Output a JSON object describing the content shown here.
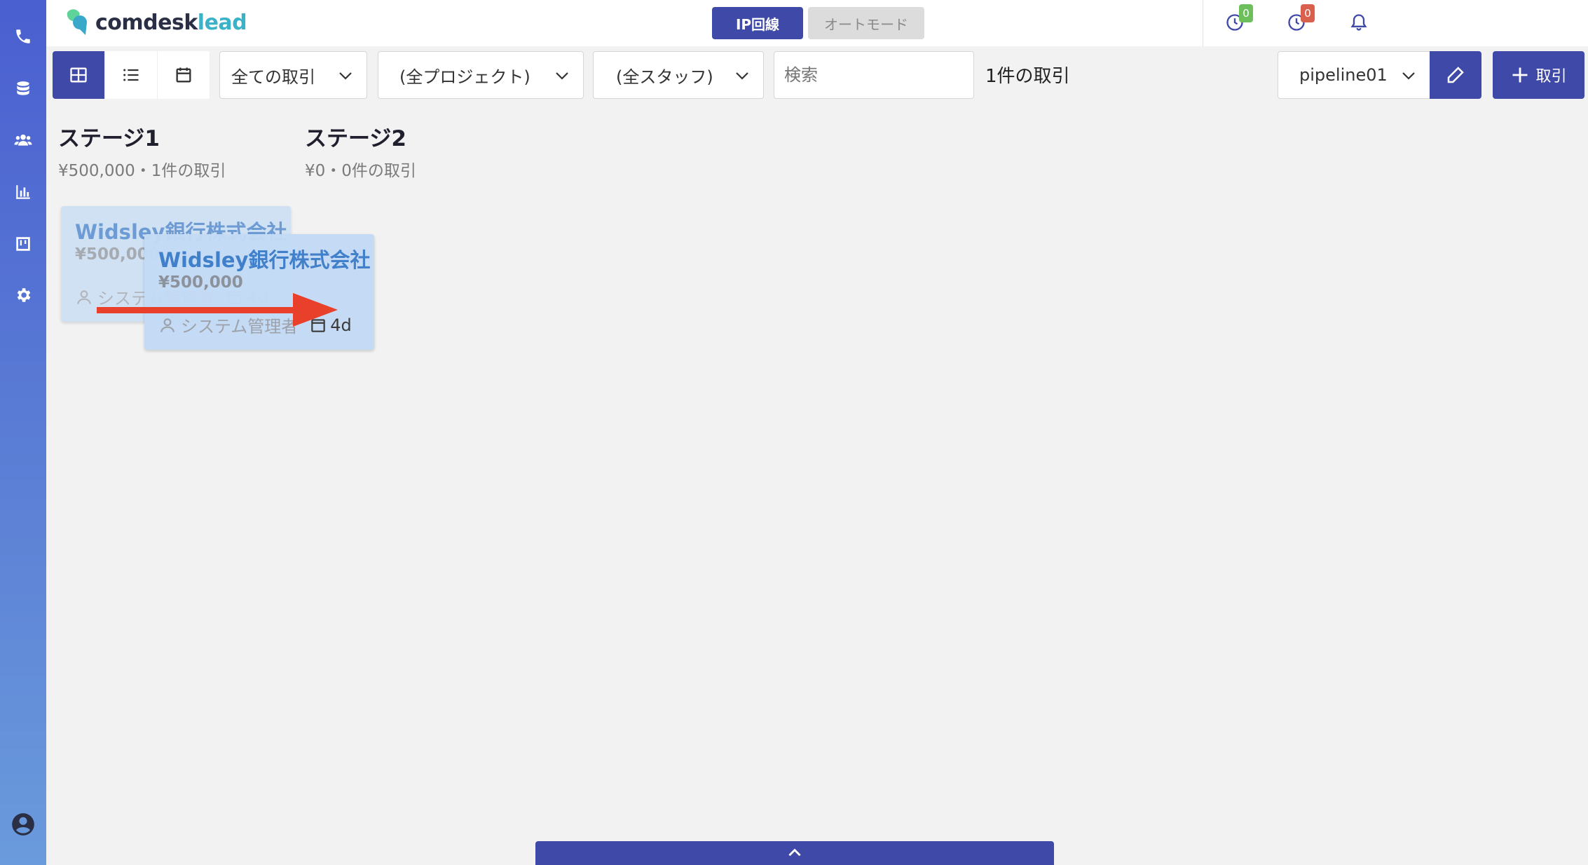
{
  "app": {
    "logo_text": "comdesk",
    "logo_text_accent": "lead"
  },
  "modes": {
    "ip_label": "IP回線",
    "auto_label": "オートモード"
  },
  "header_icons": {
    "timer_green_count": "0",
    "timer_red_count": "0",
    "green_color": "#6cbf5b",
    "red_color": "#d9604c"
  },
  "sidebar": {
    "items": [
      "phone-icon",
      "database-icon",
      "users-icon",
      "chart-icon",
      "board-icon",
      "settings-icon"
    ],
    "bottom": "account-icon"
  },
  "toolbar": {
    "views": [
      "board-view-icon",
      "list-view-icon",
      "calendar-view-icon"
    ],
    "deal_filter": "全ての取引",
    "project_filter": "(全プロジェクト)",
    "staff_filter": "(全スタッフ)",
    "search_placeholder": "検索",
    "deal_count": "1件の取引",
    "pipeline": "pipeline01",
    "add_label": "取引"
  },
  "stages": [
    {
      "title": "ステージ1",
      "summary": "¥500,000・1件の取引"
    },
    {
      "title": "ステージ2",
      "summary": "¥0・0件の取引"
    }
  ],
  "card": {
    "company": "Widsley銀行株式会社",
    "amount": "¥500,000",
    "owner": "システム管理者",
    "age": "4d"
  },
  "colors": {
    "primary": "#3f4aa8",
    "card_bg": "#c4dbf6",
    "card_title": "#3b7cc9",
    "arrow": "#e8402a"
  }
}
